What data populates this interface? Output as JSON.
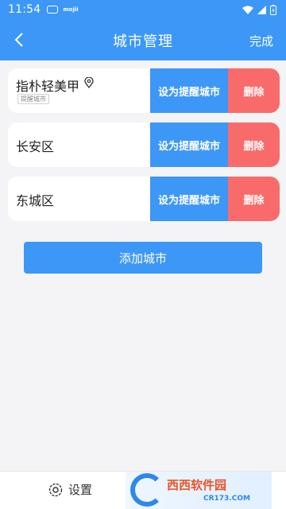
{
  "status_bar": {
    "time": "11:54",
    "app_label": "mojii"
  },
  "header": {
    "title": "城市管理",
    "done_label": "完成"
  },
  "cities": [
    {
      "name": "指朴轻美甲",
      "badge": "提醒城市",
      "remind_label": "设为提醒城市",
      "delete_label": "删除"
    },
    {
      "name": "长安区",
      "remind_label": "设为提醒城市",
      "delete_label": "删除"
    },
    {
      "name": "东城区",
      "remind_label": "设为提醒城市",
      "delete_label": "删除"
    }
  ],
  "add_city_label": "添加城市",
  "bottom_bar": {
    "settings_label": "设置"
  },
  "watermark": {
    "text": "西西软件园",
    "sub": "CR173.COM"
  },
  "colors": {
    "primary": "#3c97f6",
    "delete": "#f96b6b",
    "background": "#f4f4f6"
  },
  "icons": [
    "back-icon",
    "location-pin-icon",
    "gear-icon",
    "wifi-icon",
    "signal-icon",
    "battery-icon"
  ]
}
